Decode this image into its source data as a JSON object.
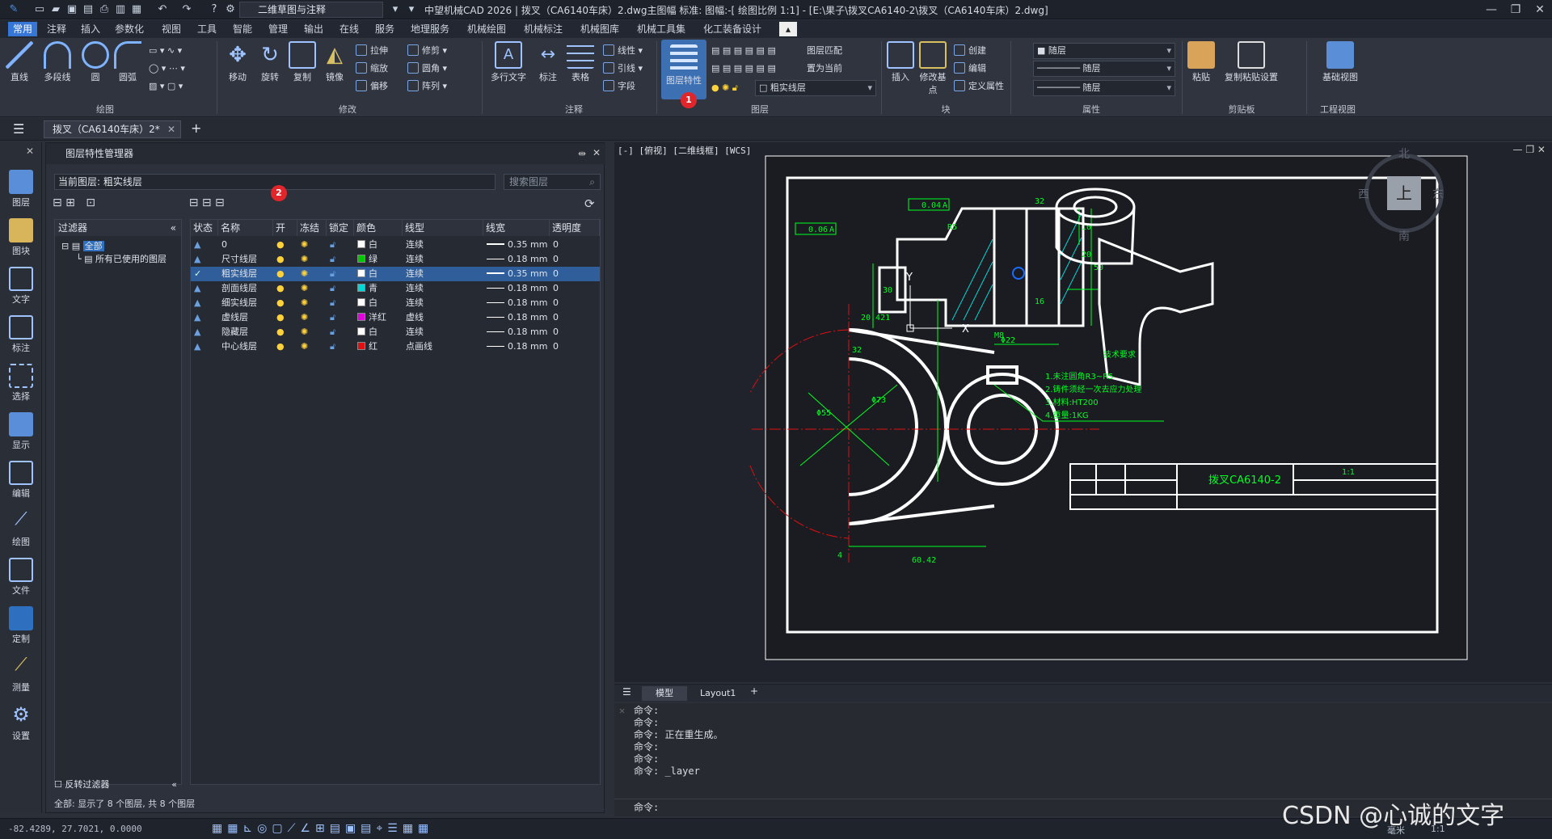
{
  "app": {
    "title": "中望机械CAD 2026 | 拨叉（CA6140车床）2.dwg主图幅  标准: 图幅:-[ 绘图比例 1:1] - [E:\\果子\\拨叉CA6140-2\\拨叉（CA6140车床）2.dwg]",
    "workspace": "二维草图与注释"
  },
  "menu": {
    "tabs": [
      "常用",
      "注释",
      "插入",
      "参数化",
      "视图",
      "工具",
      "智能",
      "管理",
      "输出",
      "在线",
      "服务",
      "地理服务",
      "机械绘图",
      "机械标注",
      "机械图库",
      "机械工具集",
      "化工装备设计"
    ]
  },
  "ribbon": {
    "draw": {
      "line": "直线",
      "pline": "多段线",
      "circle": "圆",
      "arc": "圆弧",
      "group": "绘图"
    },
    "modify": {
      "move": "移动",
      "rotate": "旋转",
      "copy": "复制",
      "mirror": "镜像",
      "stretch": "拉伸",
      "scale": "缩放",
      "offset": "偏移",
      "trim": "修剪",
      "fillet": "圆角",
      "array": "阵列",
      "group": "修改"
    },
    "annotate": {
      "mtext": "多行文字",
      "dim": "标注",
      "table": "表格",
      "linear": "线性",
      "leader": "引线",
      "field": "字段",
      "group": "注释"
    },
    "layers": {
      "props": "图层特性",
      "match": "图层匹配",
      "setcur": "置为当前",
      "current": "粗实线层",
      "group": "图层"
    },
    "block": {
      "insert": "插入",
      "edit": "修改基点",
      "create": "创建",
      "editb": "编辑",
      "attdef": "定义属性",
      "group": "块"
    },
    "props": {
      "color": "随层",
      "ltype": "随层",
      "lweight": "随层",
      "group": "属性"
    },
    "clip": {
      "paste": "粘贴",
      "copyset": "复制粘贴设置",
      "group": "剪贴板"
    },
    "view": {
      "base": "基础视图",
      "group": "工程视图"
    }
  },
  "doc_tab": "拨叉（CA6140车床）2*",
  "left_tools": [
    "图层",
    "图块",
    "文字",
    "标注",
    "选择",
    "显示",
    "编辑",
    "绘图",
    "文件",
    "定制",
    "测量",
    "设置"
  ],
  "panel": {
    "title": "图层特性管理器",
    "current_layer": "当前图层: 粗实线层",
    "search_placeholder": "搜索图层",
    "filter_header": "过滤器",
    "filter_all": "全部",
    "filter_used": "所有已使用的图层",
    "invert": "反转过滤器",
    "status": "全部: 显示了 8 个图层, 共 8 个图层",
    "columns": [
      "状态",
      "名称",
      "开",
      "冻结",
      "锁定",
      "颜色",
      "线型",
      "线宽",
      "透明度"
    ],
    "layers": [
      {
        "name": "0",
        "color": "白",
        "hex": "#ffffff",
        "ltype": "连续",
        "lw": "0.35 mm",
        "tr": "0",
        "sel": false
      },
      {
        "name": "尺寸线层",
        "color": "绿",
        "hex": "#00c800",
        "ltype": "连续",
        "lw": "0.18 mm",
        "tr": "0",
        "sel": false
      },
      {
        "name": "粗实线层",
        "color": "白",
        "hex": "#ffffff",
        "ltype": "连续",
        "lw": "0.35 mm",
        "tr": "0",
        "sel": true
      },
      {
        "name": "剖面线层",
        "color": "青",
        "hex": "#00d8d8",
        "ltype": "连续",
        "lw": "0.18 mm",
        "tr": "0",
        "sel": false
      },
      {
        "name": "细实线层",
        "color": "白",
        "hex": "#ffffff",
        "ltype": "连续",
        "lw": "0.18 mm",
        "tr": "0",
        "sel": false
      },
      {
        "name": "虚线层",
        "color": "洋红",
        "hex": "#e000e0",
        "ltype": "虚线",
        "lw": "0.18 mm",
        "tr": "0",
        "sel": false
      },
      {
        "name": "隐藏层",
        "color": "白",
        "hex": "#ffffff",
        "ltype": "连续",
        "lw": "0.18 mm",
        "tr": "0",
        "sel": false
      },
      {
        "name": "中心线层",
        "color": "红",
        "hex": "#e01010",
        "ltype": "点画线",
        "lw": "0.18 mm",
        "tr": "0",
        "sel": false
      }
    ]
  },
  "viewport": {
    "label": "[-] [俯视] [二维线框] [WCS]",
    "viewcube": {
      "top": "上",
      "north": "北",
      "south": "南",
      "east": "东",
      "west": "西"
    },
    "drawing": {
      "tol1": "0.04",
      "tol1ref": "A",
      "tol2": "0.06",
      "tol2ref": "A",
      "dim_r5": "R5",
      "dim_32": "32",
      "dim_10": "10",
      "dim_20": "20",
      "dim_50": "50",
      "dim_30": "30",
      "dim_16": "16",
      "dim_bore": "20.421",
      "dim_phi22": "Φ22",
      "dim_m8": "M8",
      "dim_phi55": "Φ55",
      "dim_phi73": "Φ73",
      "dim_60": "60.42",
      "dim_4": "4",
      "tech_title": "技术要求",
      "tech1": "1.未注圆角R3~R5",
      "tech2": "2.铸件须经一次去应力处理",
      "tech3": "3.材料:HT200",
      "tech4": "4.重量:1KG",
      "part": "拨叉CA6140-2",
      "scale": "1:1"
    }
  },
  "layout_tabs": {
    "model": "模型",
    "layout1": "Layout1"
  },
  "command": {
    "lines": [
      "命令:",
      "命令:",
      "命令: 正在重生成。",
      "命令:",
      "命令:",
      "命令: _layer"
    ],
    "prompt": "命令:"
  },
  "status": {
    "coords": "-82.4289, 27.7021, 0.0000",
    "units": "毫米",
    "scale": "1:1"
  },
  "watermark": "CSDN @心诚的文字",
  "markers": {
    "m1": "1",
    "m2": "2"
  }
}
